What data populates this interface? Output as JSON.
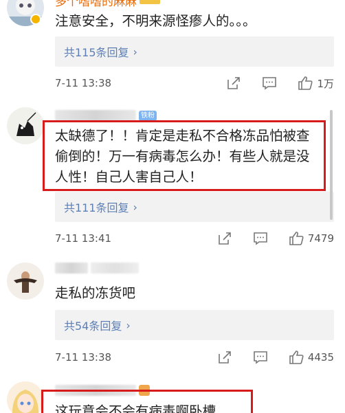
{
  "comments": [
    {
      "username": "多个嗜嗜的麻麻",
      "text": "注意安全，不明来源怪瘆人的。。。",
      "replies_label": "共115条回复",
      "timestamp": "7-11 13:38",
      "likes": "1万",
      "verified": true
    },
    {
      "badge": "铁粉",
      "text_lines": [
        "太缺德了！！肯定是走私不合格冻品怕被查",
        "偷倒的！万一有病毒怎么办！有些人就是没",
        "人性！自己人害自己人！"
      ],
      "replies_label": "共111条回复",
      "timestamp": "7-11 13:41",
      "likes": "7479"
    },
    {
      "text": "走私的冻货吧",
      "replies_label": "共54条回复",
      "timestamp": "7-11 13:38",
      "likes": "4435"
    },
    {
      "text": "这玩意会不会有病毒啊卧槽"
    }
  ],
  "icons": {
    "chevron": "chevron-right-icon",
    "share": "share-icon",
    "comment": "comment-icon",
    "like": "thumbs-up-icon"
  },
  "colors": {
    "highlight": "#d71a1a",
    "link": "#5b7fb6",
    "username": "#e86b0a"
  }
}
